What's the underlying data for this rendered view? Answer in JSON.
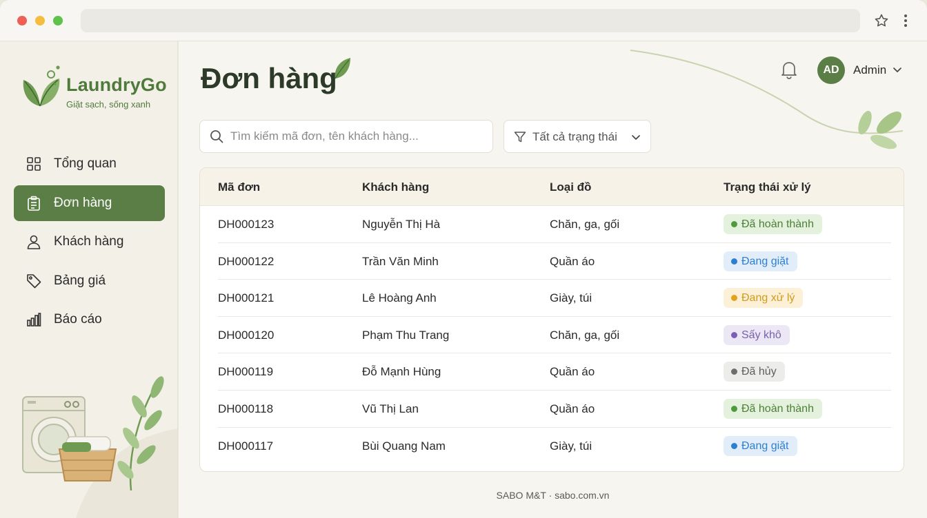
{
  "brand": {
    "name": "LaundryGo",
    "tagline": "Giặt sạch, sống xanh"
  },
  "nav": {
    "items": [
      {
        "label": "Tổng quan",
        "icon": "grid-icon",
        "active": false
      },
      {
        "label": "Đơn hàng",
        "icon": "clipboard-icon",
        "active": true
      },
      {
        "label": "Khách hàng",
        "icon": "user-icon",
        "active": false
      },
      {
        "label": "Bảng giá",
        "icon": "tag-icon",
        "active": false
      },
      {
        "label": "Báo cáo",
        "icon": "bar-chart-icon",
        "active": false
      }
    ]
  },
  "header": {
    "title": "Đơn hàng",
    "user": {
      "initials": "AD",
      "name": "Admin"
    }
  },
  "search": {
    "placeholder": "Tìm kiếm mã đơn, tên khách hàng...",
    "value": ""
  },
  "filter": {
    "label": "Tất cả trạng thái"
  },
  "table": {
    "columns": [
      "Mã đơn",
      "Khách hàng",
      "Loại đồ",
      "Trạng thái xử lý"
    ],
    "rows": [
      {
        "id": "DH000123",
        "customer": "Nguyễn Thị Hà",
        "type": "Chăn, ga, gối",
        "status": "Đã hoàn thành",
        "status_kind": "done"
      },
      {
        "id": "DH000122",
        "customer": "Trần Văn Minh",
        "type": "Quần áo",
        "status": "Đang giặt",
        "status_kind": "wash"
      },
      {
        "id": "DH000121",
        "customer": "Lê Hoàng Anh",
        "type": "Giày, túi",
        "status": "Đang xử lý",
        "status_kind": "proc"
      },
      {
        "id": "DH000120",
        "customer": "Phạm Thu Trang",
        "type": "Chăn, ga, gối",
        "status": "Sấy khô",
        "status_kind": "dry"
      },
      {
        "id": "DH000119",
        "customer": "Đỗ Mạnh Hùng",
        "type": "Quần áo",
        "status": "Đã hủy",
        "status_kind": "cancel"
      },
      {
        "id": "DH000118",
        "customer": "Vũ Thị Lan",
        "type": "Quần áo",
        "status": "Đã hoàn thành",
        "status_kind": "done"
      },
      {
        "id": "DH000117",
        "customer": "Bùi Quang Nam",
        "type": "Giày, túi",
        "status": "Đang giặt",
        "status_kind": "wash"
      }
    ]
  },
  "footer": {
    "text": "SABO M&T · sabo.com.vn"
  },
  "colors": {
    "accent": "#5a7e45",
    "brand_text": "#4f7a3b",
    "status_done": "#4e9a3c",
    "status_wash": "#2f7fcf",
    "status_proc": "#e3a21c",
    "status_dry": "#7a5fb5",
    "status_cancel": "#6e6e6e"
  }
}
